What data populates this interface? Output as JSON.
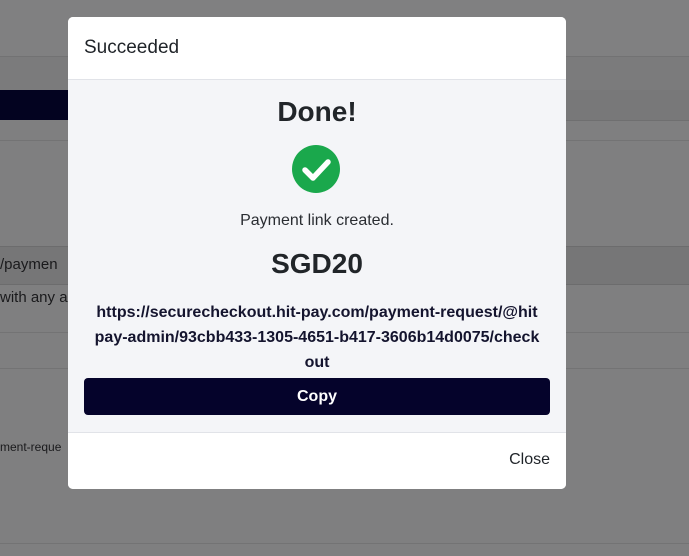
{
  "background": {
    "row_text": "/paymen",
    "row2_text": "with any a",
    "row3_text": "ment-reque"
  },
  "modal": {
    "title": "Succeeded",
    "heading": "Done!",
    "status_icon": "check-circle-icon",
    "message": "Payment link created.",
    "amount": "SGD20",
    "link": "https://securecheckout.hit-pay.com/payment-request/@hitpay-admin/93cbb433-1305-4651-b417-3606b14d0075/checkout",
    "copy_label": "Copy",
    "close_label": "Close"
  },
  "colors": {
    "success": "#1aa84c",
    "primary_button": "#05032b",
    "overlay": "#7f7f80"
  }
}
